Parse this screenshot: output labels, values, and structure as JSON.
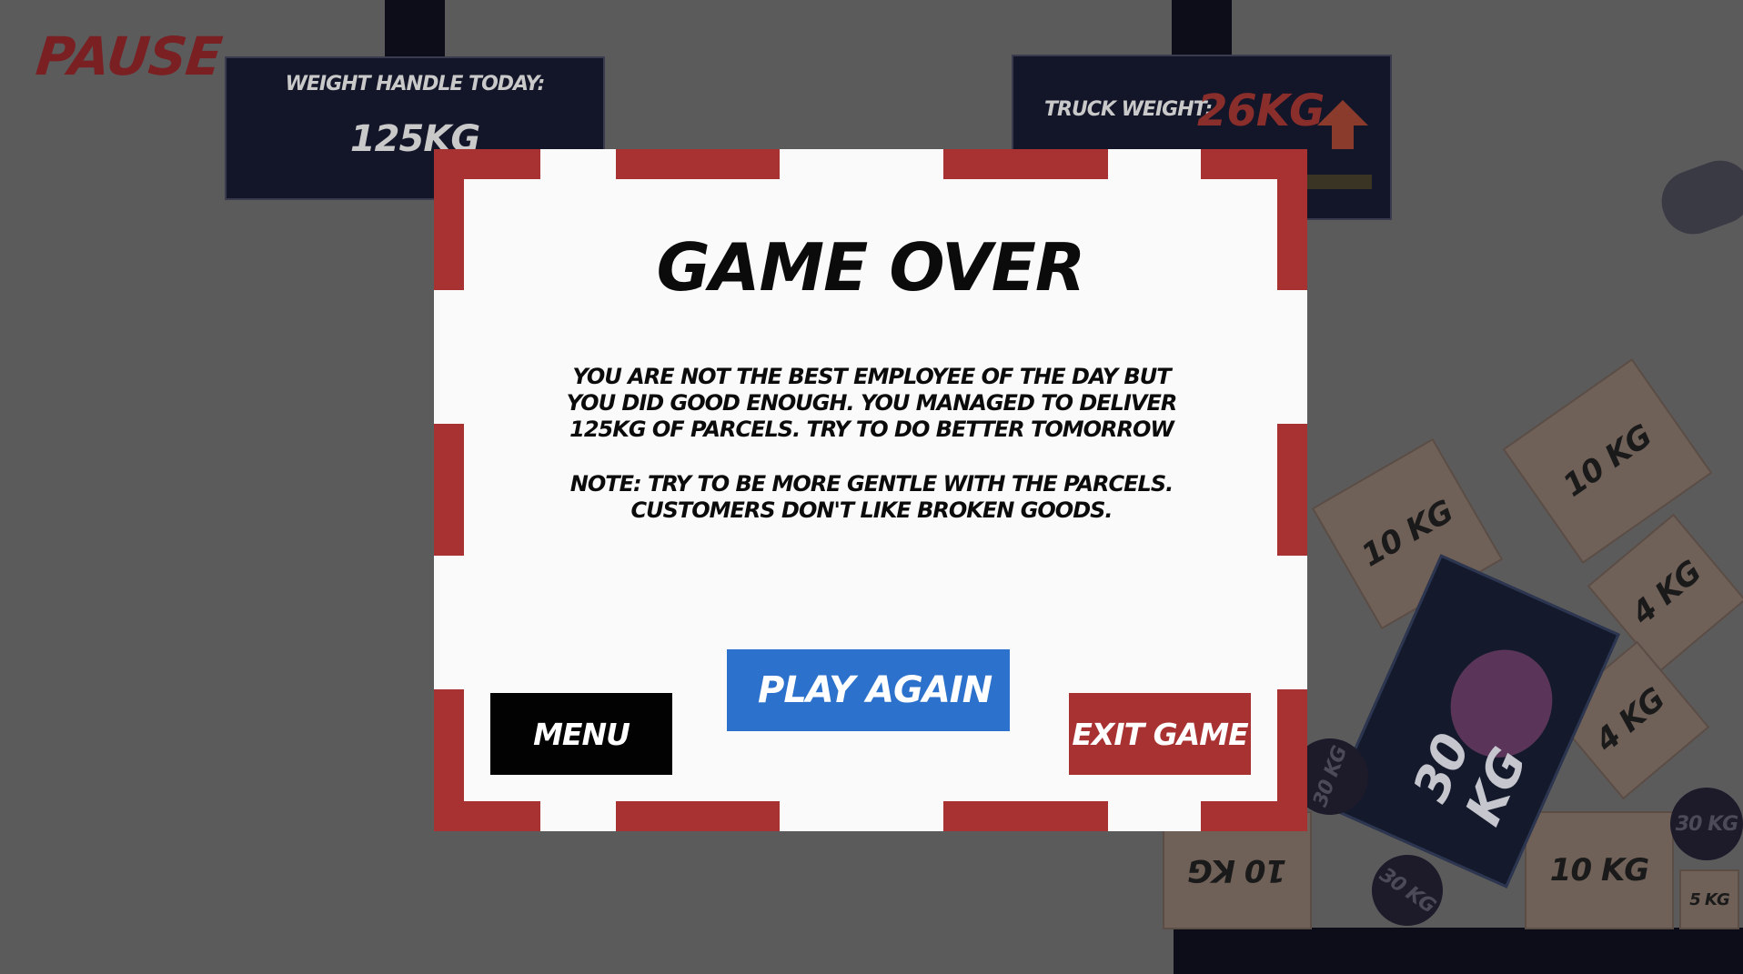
{
  "hud": {
    "pause_label": "PAUSE",
    "weight_today_label": "WEIGHT HANDLE TODAY:",
    "weight_today_value": "125KG",
    "truck_weight_label": "TRUCK WEIGHT:",
    "truck_weight_value": "26KG"
  },
  "scene": {
    "boxes": [
      {
        "label": "10 KG"
      },
      {
        "label": "10 KG"
      },
      {
        "label": "4 KG"
      },
      {
        "label": "4 KG"
      },
      {
        "label": "10 KG"
      },
      {
        "label": "10 KG"
      },
      {
        "label": "5 KG"
      }
    ],
    "kettlebells": [
      {
        "label": "30 KG"
      },
      {
        "label": "30 KG"
      },
      {
        "label": "30 KG"
      }
    ],
    "poster_label": "30 KG"
  },
  "modal": {
    "title": "GAME OVER",
    "message": "YOU ARE NOT THE BEST EMPLOYEE OF THE DAY BUT YOU DID GOOD ENOUGH. YOU MANAGED TO DELIVER 125KG OF PARCELS. TRY TO DO BETTER TOMORROW",
    "note": "NOTE: TRY TO BE MORE GENTLE WITH THE PARCELS. CUSTOMERS DON'T LIKE BROKEN GOODS.",
    "buttons": {
      "menu": "MENU",
      "play_again": "PLAY AGAIN",
      "exit_game": "EXIT GAME"
    }
  },
  "colors": {
    "accent_red": "#a83232",
    "play_blue": "#2c72cc",
    "overlay_gray": "#5c5b5c"
  }
}
